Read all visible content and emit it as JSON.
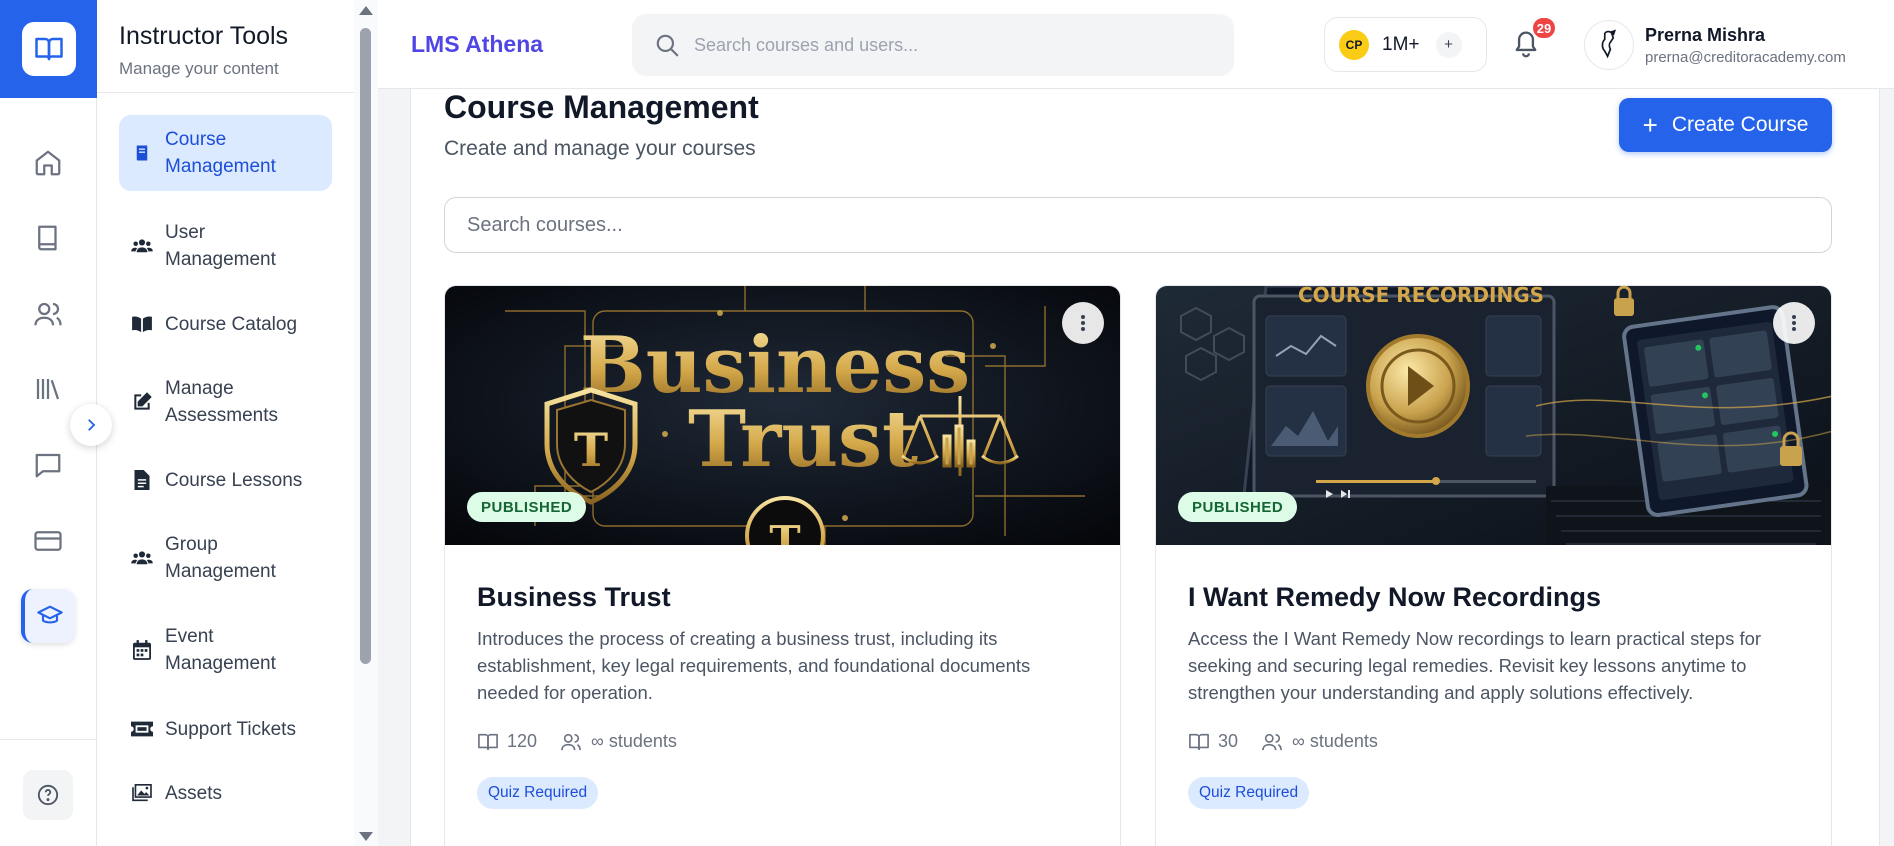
{
  "sidebar": {
    "title": "Instructor Tools",
    "subtitle": "Manage your content",
    "items": [
      {
        "label": "Course Management"
      },
      {
        "label": "User Management"
      },
      {
        "label": "Course Catalog"
      },
      {
        "label": "Manage Assessments"
      },
      {
        "label": "Course Lessons"
      },
      {
        "label": "Group Management"
      },
      {
        "label": "Event Management"
      },
      {
        "label": "Support Tickets"
      },
      {
        "label": "Assets"
      }
    ]
  },
  "rail": {
    "icons": [
      "book-open-icon",
      "home-icon",
      "book-icon",
      "users-icon",
      "library-icon",
      "chat-icon",
      "card-icon",
      "graduation-cap-icon",
      "help-icon"
    ]
  },
  "header": {
    "brand": "LMS Athena",
    "search_placeholder": "Search courses and users...",
    "credits_badge": "CP",
    "credits_value": "1M+",
    "credits_add": "+",
    "notifications_count": "29",
    "user_name": "Prerna Mishra",
    "user_email": "prerna@creditoracademy.com"
  },
  "main": {
    "title": "Course Management",
    "subtitle": "Create and manage your courses",
    "create_label": "Create Course",
    "search_placeholder": "Search courses...",
    "courses": [
      {
        "image_title_line1": "Business",
        "image_title_line2": "Trust",
        "image_letter": "T",
        "status": "PUBLISHED",
        "title": "Business Trust",
        "description": "Introduces the process of creating a business trust, including its establishment, key legal requirements, and foundational documents needed for operation.",
        "lessons": "120",
        "students": "∞ students",
        "tag": "Quiz Required"
      },
      {
        "image_title": "COURSE RECORDINGS",
        "status": "PUBLISHED",
        "title": "I Want Remedy Now Recordings",
        "description": "Access the I Want Remedy Now recordings to learn practical steps for seeking and securing legal remedies. Revisit key lessons anytime to strengthen your understanding and apply solutions effectively.",
        "lessons": "30",
        "students": "∞ students",
        "tag": "Quiz Required"
      }
    ]
  },
  "colors": {
    "primary": "#2563eb",
    "brand": "#4f46e5",
    "published_bg": "#dcfce7",
    "badge_red": "#ef4444"
  }
}
